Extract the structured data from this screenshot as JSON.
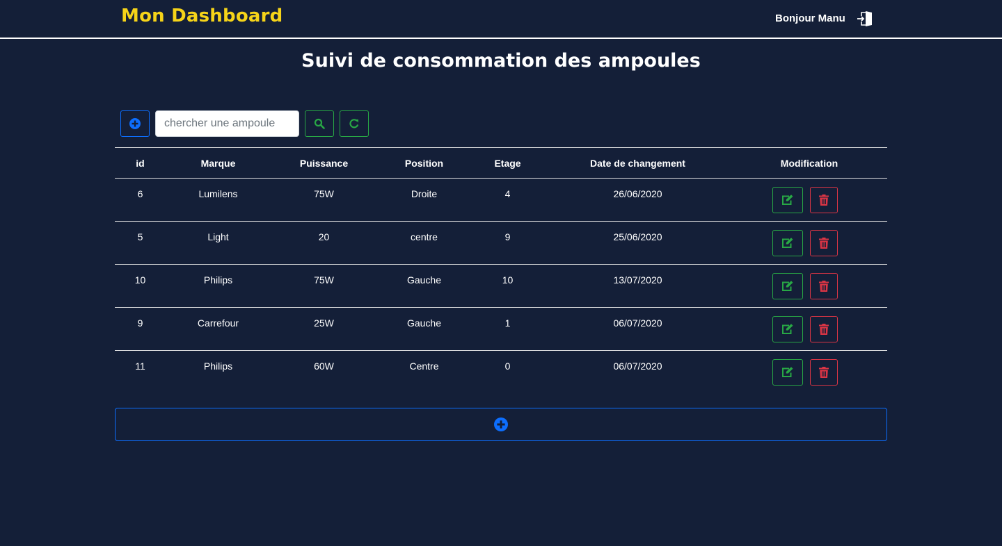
{
  "navbar": {
    "brand": "Mon Dashboard",
    "greeting": "Bonjour Manu",
    "logout_icon": "logout-door-icon"
  },
  "page": {
    "title": "Suivi de consommation des ampoules"
  },
  "toolbar": {
    "add_icon": "plus-circle-icon",
    "search_placeholder": "chercher une ampoule",
    "search_value": "",
    "search_icon": "search-icon",
    "refresh_icon": "refresh-icon"
  },
  "table": {
    "columns": [
      "id",
      "Marque",
      "Puissance",
      "Position",
      "Etage",
      "Date de changement",
      "Modification"
    ],
    "rows": [
      {
        "id": "6",
        "marque": "Lumilens",
        "puissance": "75W",
        "position": "Droite",
        "etage": "4",
        "date": "26/06/2020"
      },
      {
        "id": "5",
        "marque": "Light",
        "puissance": "20",
        "position": "centre",
        "etage": "9",
        "date": "25/06/2020"
      },
      {
        "id": "10",
        "marque": "Philips",
        "puissance": "75W",
        "position": "Gauche",
        "etage": "10",
        "date": "13/07/2020"
      },
      {
        "id": "9",
        "marque": "Carrefour",
        "puissance": "25W",
        "position": "Gauche",
        "etage": "1",
        "date": "06/07/2020"
      },
      {
        "id": "11",
        "marque": "Philips",
        "puissance": "60W",
        "position": "Centre",
        "etage": "0",
        "date": "06/07/2020"
      }
    ],
    "edit_icon": "edit-icon",
    "delete_icon": "trash-icon"
  },
  "footer": {
    "add_icon": "plus-circle-icon"
  },
  "colors": {
    "background": "#141f38",
    "brand": "#f5d319",
    "primary": "#0d6efd",
    "success": "#28a745",
    "danger": "#dc3545"
  }
}
